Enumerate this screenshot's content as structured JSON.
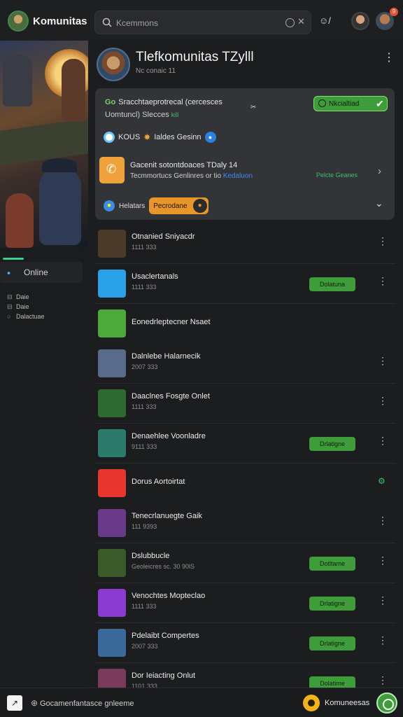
{
  "app": {
    "title": "Komunitas"
  },
  "search": {
    "placeholder": "Kcemmons",
    "mood_text": "☺/"
  },
  "notification_count": "9",
  "profile": {
    "name": "Tlefkomunitas TZylll",
    "subtitle": "Nc conaic 11",
    "more": "⋮"
  },
  "card": {
    "line1": "Sracchtaeprotrecal (cercesces",
    "go": "Go",
    "line1_tail": "✂",
    "line1b": "Uomtuncl) Slecces",
    "line1b_tag": "kill",
    "status_label": "Nkcialtiad",
    "status_check": "✔",
    "line2": "KOUS",
    "line2_mid": "Ialdes Gesinn",
    "line3a": "Gacenit sotontdoaces TDaly 14",
    "line3b": "Tecmmortucs",
    "line3b_mid": "Genlinres or tio",
    "line3b_blue": "Kedaluon",
    "line3c": "Pelcte Geanes",
    "line4_label": "Helatars",
    "line4_pill": "Pecrodane",
    "chevron": "⌄"
  },
  "online": {
    "label": "Online"
  },
  "sidebar": {
    "items": [
      {
        "icon": "⊟",
        "label": "Daie"
      },
      {
        "icon": "⊟",
        "label": "Daie"
      },
      {
        "icon": "○",
        "label": "Dalactuae"
      }
    ]
  },
  "list": [
    {
      "title": "Otnanied Sniyacdr",
      "sub": "1111 333",
      "button": "",
      "thumb": "#4a3a2a"
    },
    {
      "title": "Usaclertanals",
      "sub": "1111 333",
      "button": "Dolatuna",
      "thumb": "#2aa0e8"
    },
    {
      "title": "Eonedrleptecner Nsaet",
      "sub": "",
      "button": "",
      "thumb": "#4caa3c",
      "section": true
    },
    {
      "title": "Dalnlebe Halarnecik",
      "sub": "2007 333",
      "button": "",
      "thumb": "#5a6a8a"
    },
    {
      "title": "Daaclnes Fosgte Onlet",
      "sub": "1111 333",
      "button": "",
      "thumb": "#2f6a32"
    },
    {
      "title": "Denaehlee Voonladre",
      "sub": "9111 333",
      "button": "Drlatigne",
      "thumb": "#2b7a6a"
    },
    {
      "title": "Dorus Aortoirtat",
      "sub": "",
      "button": "",
      "thumb": "#e8352e",
      "section": true,
      "gicon": "⚙"
    },
    {
      "title": "Tenecrlanuegte Gaik",
      "sub": "111 9393",
      "button": "",
      "thumb": "#6a3a8a"
    },
    {
      "title": "Dslubbucle",
      "sub": "Geoleicres sc. 30 90lS",
      "button": "Dotltame",
      "thumb": "#3a5a2a"
    },
    {
      "title": "Venochtes Mopteclao",
      "sub": "1111 333",
      "button": "Drlatigne",
      "thumb": "#8a3ad0"
    },
    {
      "title": "Pdelaibt Compertes",
      "sub": "2007 333",
      "button": "Drlatigne",
      "thumb": "#3a6a9a"
    },
    {
      "title": "Dor Ieiacting Onlut",
      "sub": "1101 333",
      "button": "Dolatime",
      "thumb": "#7a3a5a"
    }
  ],
  "bottom": {
    "left_text": "Gocamenfantasce gnleeme",
    "right_label": "Komuneesas",
    "left_icon": "↗"
  }
}
